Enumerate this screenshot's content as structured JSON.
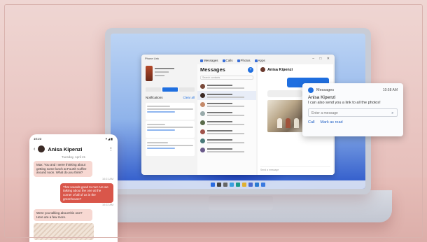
{
  "laptop_app": {
    "window_title": "Phone Link",
    "tabs": [
      {
        "label": "Messages"
      },
      {
        "label": "Calls"
      },
      {
        "label": "Photos"
      },
      {
        "label": "Apps"
      }
    ],
    "notifications_title": "Notifications",
    "clear_all": "Clear all",
    "messages_title": "Messages",
    "search_placeholder": "Search contacts",
    "chat_name": "Anisa Kipenzi",
    "chat_input_placeholder": "Send a message"
  },
  "toast": {
    "app_name": "Messages",
    "time": "10:58 AM",
    "sender": "Anisa Kipenzi",
    "body": "I can also send you a link to all the photos!",
    "input_placeholder": "Enter a message",
    "send_icon": "send-arrow",
    "actions": [
      "Call",
      "Mark as read"
    ]
  },
  "phone": {
    "time": "10:23",
    "contact_name": "Anisa Kipenzi",
    "day_label": "Tuesday, April 21",
    "messages": [
      {
        "dir": "in",
        "text": "Max: You and I were thinking about getting some lunch at Fourth Coffee around noon. What do you think?",
        "time": "10:21 AM"
      },
      {
        "dir": "out",
        "text": "That sounds good to me! Are we talking about the one at the corner of all of us in the greenhouse?",
        "time": "10:22 AM"
      },
      {
        "dir": "in",
        "text": "Were you talking about this one? Here are a few more.",
        "time": ""
      }
    ]
  },
  "colors": {
    "accent": "#1f6fe0",
    "phone_outgoing": "#d9564a",
    "phone_incoming": "#f7d8d2",
    "background": "#e9c9c6"
  }
}
